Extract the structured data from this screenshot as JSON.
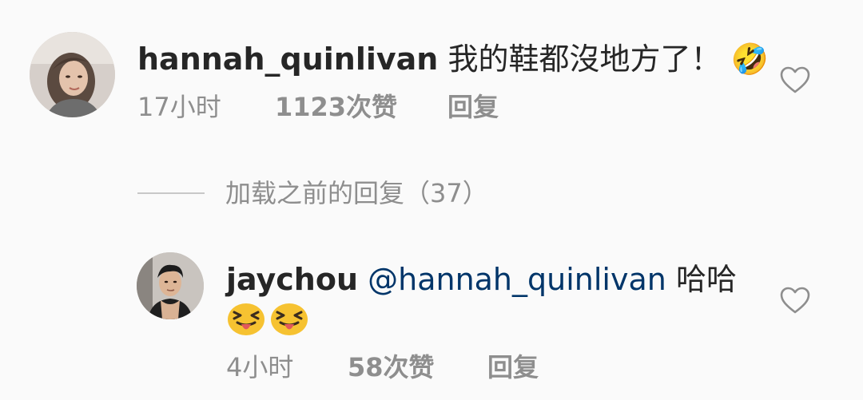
{
  "comment": {
    "username": "hannah_quinlivan",
    "text": "我的鞋都沒地方了！",
    "trailing_glyph": "🤣",
    "time": "17小时",
    "likes": "1123次赞",
    "reply": "回复",
    "avatar": "woman-avatar",
    "like_icon": "heart-outline-icon"
  },
  "load_previous": {
    "label": "加载之前的回复（37）"
  },
  "reply": {
    "username": "jaychou",
    "mention": "@hannah_quinlivan",
    "text": "哈哈",
    "emojis": [
      "squinting-face-with-tongue",
      "squinting-face-with-tongue"
    ],
    "time": "4小时",
    "likes": "58次赞",
    "reply": "回复",
    "avatar": "man-avatar",
    "like_icon": "heart-outline-icon"
  },
  "colors": {
    "background": "#fafafa",
    "text_primary": "#262626",
    "text_secondary": "#8e8e8e",
    "mention": "#003569",
    "emoji_yellow": "#f6c231"
  }
}
